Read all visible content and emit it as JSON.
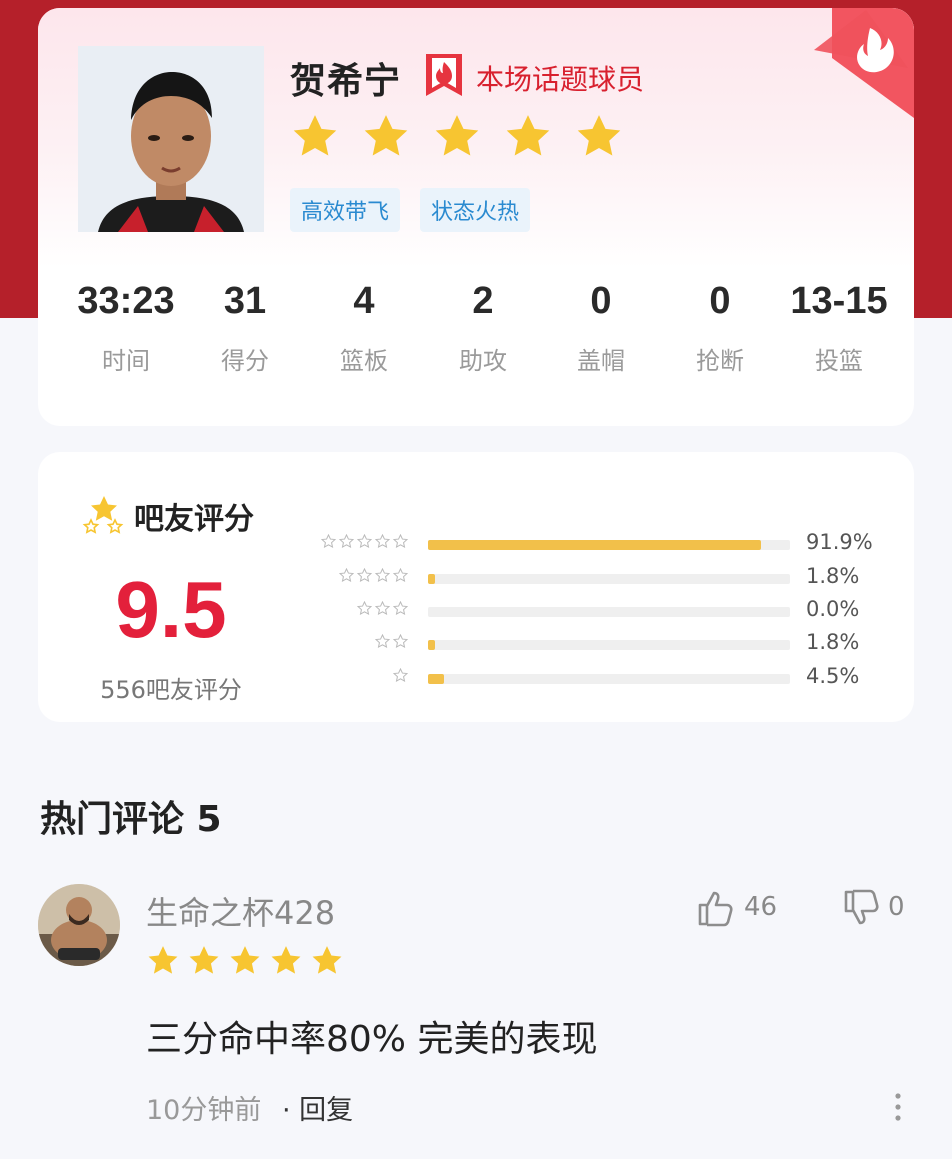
{
  "player": {
    "name": "贺希宁",
    "hot_label": "本场话题球员",
    "rating_stars": 5,
    "tags": [
      "高效带飞",
      "状态火热"
    ]
  },
  "stats": [
    {
      "value": "33:23",
      "label": "时间"
    },
    {
      "value": "31",
      "label": "得分"
    },
    {
      "value": "4",
      "label": "篮板"
    },
    {
      "value": "2",
      "label": "助攻"
    },
    {
      "value": "0",
      "label": "盖帽"
    },
    {
      "value": "0",
      "label": "抢断"
    },
    {
      "value": "13-15",
      "label": "投篮"
    }
  ],
  "fan_rating": {
    "title": "吧友评分",
    "score": "9.5",
    "count_text": "556吧友评分",
    "distribution": [
      {
        "stars": 5,
        "percent": 91.9,
        "label": "91.9%"
      },
      {
        "stars": 4,
        "percent": 1.8,
        "label": "1.8%"
      },
      {
        "stars": 3,
        "percent": 0.0,
        "label": "0.0%"
      },
      {
        "stars": 2,
        "percent": 1.8,
        "label": "1.8%"
      },
      {
        "stars": 1,
        "percent": 4.5,
        "label": "4.5%"
      }
    ]
  },
  "comments_section": {
    "title": "热门评论 5"
  },
  "comment": {
    "username": "生命之杯428",
    "likes": "46",
    "dislikes": "0",
    "stars": 5,
    "text": "三分命中率80% 完美的表现",
    "time": "10分钟前",
    "reply_label": "· 回复"
  },
  "colors": {
    "brand_red": "#b5202a",
    "score_red": "#e3203b",
    "star_gold": "#f7c531",
    "bar_fill": "#f2c04a",
    "tag_blue": "#2a8ad0"
  },
  "icons": {
    "corner": "flame-badge-icon",
    "hot": "flame-bookmark-icon",
    "rating": "stars-icon",
    "like": "thumbs-up-icon",
    "dislike": "thumbs-down-icon",
    "more": "more-vertical-icon"
  }
}
